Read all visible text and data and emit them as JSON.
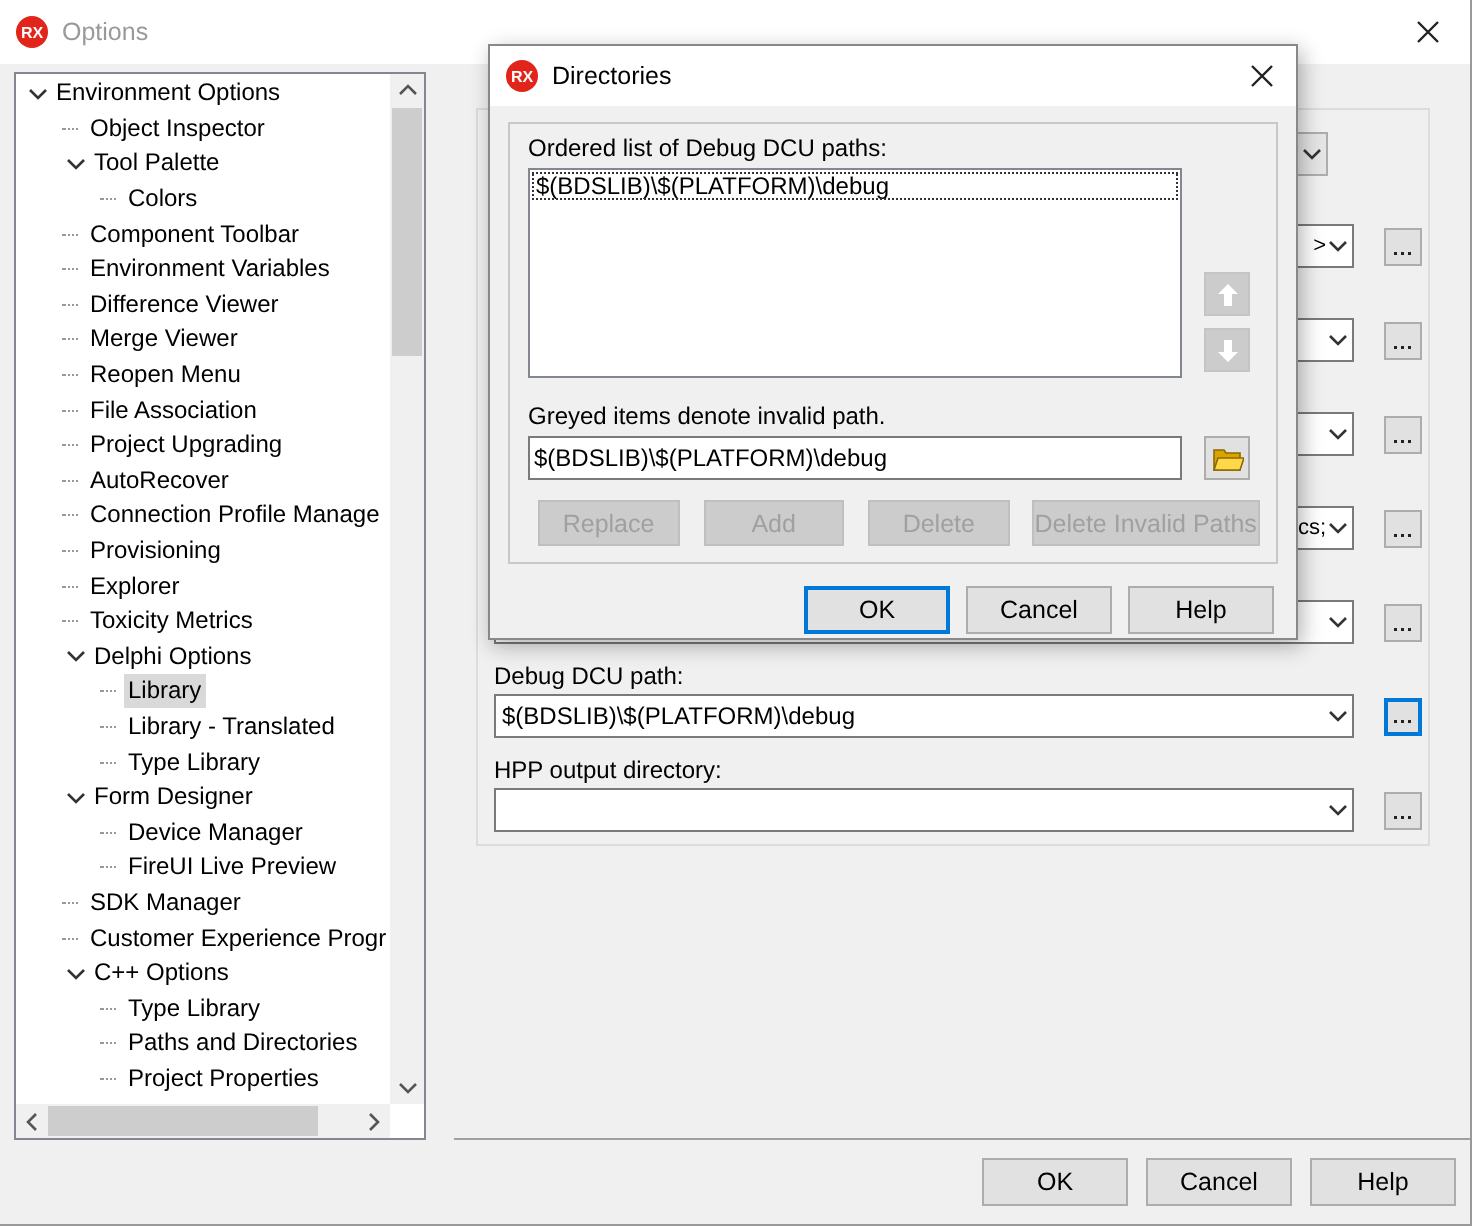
{
  "window": {
    "logo": "RX",
    "title": "Options",
    "active": false
  },
  "tree": {
    "items": [
      {
        "label": "Environment Options",
        "expanded": true,
        "selected": false,
        "children": [
          {
            "label": "Object Inspector",
            "selected": false
          },
          {
            "label": "Tool Palette",
            "expanded": true,
            "selected": false,
            "children": [
              {
                "label": "Colors",
                "selected": false
              }
            ]
          },
          {
            "label": "Component Toolbar",
            "selected": false
          },
          {
            "label": "Environment Variables",
            "selected": false
          },
          {
            "label": "Difference Viewer",
            "selected": false
          },
          {
            "label": "Merge Viewer",
            "selected": false
          },
          {
            "label": "Reopen Menu",
            "selected": false
          },
          {
            "label": "File Association",
            "selected": false
          },
          {
            "label": "Project Upgrading",
            "selected": false
          },
          {
            "label": "AutoRecover",
            "selected": false
          },
          {
            "label": "Connection Profile Manage",
            "selected": false
          },
          {
            "label": "Provisioning",
            "selected": false
          },
          {
            "label": "Explorer",
            "selected": false
          },
          {
            "label": "Toxicity Metrics",
            "selected": false
          },
          {
            "label": "Delphi Options",
            "expanded": true,
            "selected": false,
            "children": [
              {
                "label": "Library",
                "selected": true
              },
              {
                "label": "Library - Translated",
                "selected": false
              },
              {
                "label": "Type Library",
                "selected": false
              }
            ]
          },
          {
            "label": "Form Designer",
            "expanded": true,
            "selected": false,
            "children": [
              {
                "label": "Device Manager",
                "selected": false
              },
              {
                "label": "FireUI Live Preview",
                "selected": false
              }
            ]
          },
          {
            "label": "SDK Manager",
            "selected": false
          },
          {
            "label": "Customer Experience Progr",
            "selected": false
          },
          {
            "label": "C++ Options",
            "expanded": true,
            "selected": false,
            "children": [
              {
                "label": "Type Library",
                "selected": false
              },
              {
                "label": "Paths and Directories",
                "selected": false
              },
              {
                "label": "Project Properties",
                "selected": false
              }
            ]
          }
        ]
      }
    ]
  },
  "settings": {
    "rows": [
      {
        "kind": "select"
      },
      {
        "kind": "path",
        "value": ">",
        "focused": false
      },
      {
        "kind": "path",
        "focused": false
      },
      {
        "kind": "path",
        "focused": false
      },
      {
        "kind": "path",
        "value": "cs;",
        "focused": false
      },
      {
        "kind": "path",
        "focused": false
      },
      {
        "kind": "path",
        "label": "Debug DCU path:",
        "value": "$(BDSLIB)\\$(PLATFORM)\\debug",
        "focused": true
      },
      {
        "kind": "path",
        "label": "HPP output directory:",
        "focused": false
      }
    ]
  },
  "buttons": [
    {
      "label": "OK",
      "default": false
    },
    {
      "label": "Cancel",
      "default": false
    },
    {
      "label": "Help",
      "default": false
    }
  ],
  "dialog": {
    "logo": "RX",
    "title": "Directories",
    "active": true,
    "list_label": "Ordered list of Debug DCU paths:",
    "items": [
      {
        "text": "$(BDSLIB)\\$(PLATFORM)\\debug",
        "selected": true
      }
    ],
    "move_up": {
      "disabled": true
    },
    "move_down": {
      "disabled": true
    },
    "hint": "Greyed items denote invalid path.",
    "path_value": "$(BDSLIB)\\$(PLATFORM)\\debug",
    "actions": [
      {
        "label": "Replace",
        "disabled": true
      },
      {
        "label": "Add",
        "disabled": true
      },
      {
        "label": "Delete",
        "disabled": true
      },
      {
        "label": "Delete Invalid Paths",
        "disabled": true
      }
    ],
    "buttons": [
      {
        "label": "OK",
        "default": true
      },
      {
        "label": "Cancel",
        "default": false
      },
      {
        "label": "Help",
        "default": false
      }
    ]
  }
}
